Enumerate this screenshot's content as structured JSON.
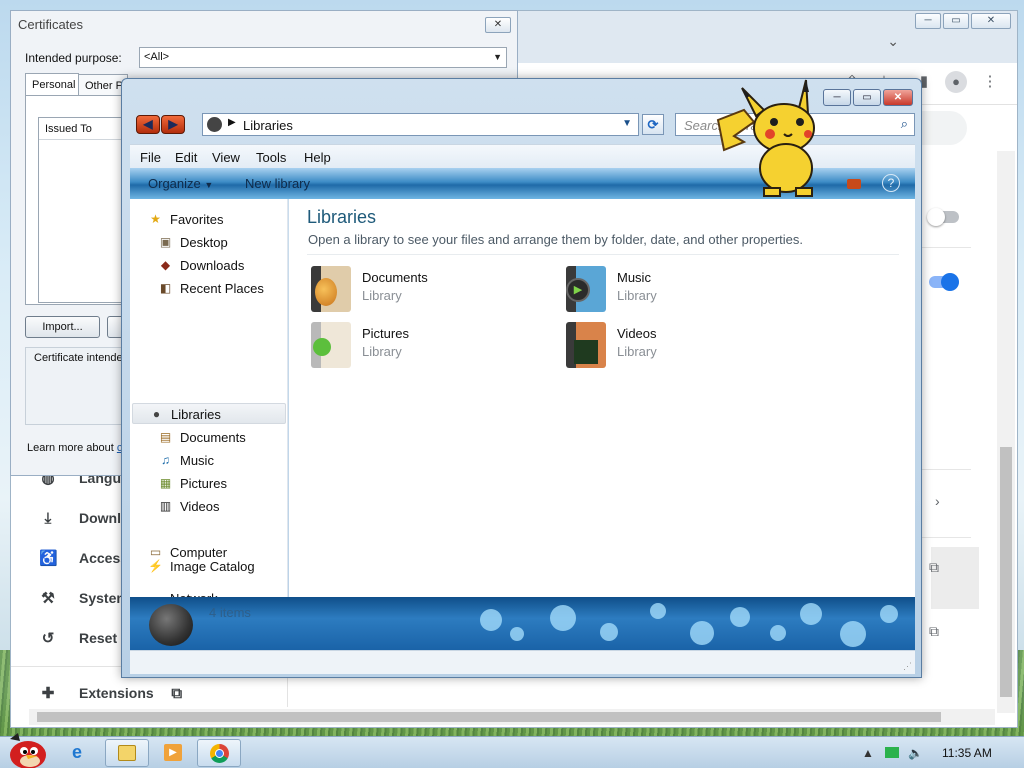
{
  "chrome": {
    "window_controls": [
      "─",
      "▭",
      "✕"
    ],
    "sidebar": [
      {
        "label": "Langua",
        "icon": "globe-icon"
      },
      {
        "label": "Downlo",
        "icon": "download-icon"
      },
      {
        "label": "Access",
        "icon": "accessibility-icon"
      },
      {
        "label": "System",
        "icon": "wrench-icon"
      },
      {
        "label": "Reset a",
        "icon": "history-icon"
      },
      {
        "label": "Extensions",
        "icon": "puzzle-icon"
      }
    ],
    "toggle_on_color": "#1a73e8"
  },
  "certificates": {
    "title": "Certificates",
    "close_glyph": "✕",
    "purpose_label": "Intended purpose:",
    "purpose_value": "<All>",
    "tabs": [
      "Personal",
      "Other Pe"
    ],
    "list_header": "Issued To",
    "import_label": "Import...",
    "purposes_label": "Certificate intende",
    "learn_prefix": "Learn more about ",
    "learn_link": "c"
  },
  "explorer": {
    "window_controls": [
      "─",
      "▭",
      "✕"
    ],
    "address": "Libraries",
    "search_placeholder": "Search Libraries",
    "menu": [
      "File",
      "Edit",
      "View",
      "Tools",
      "Help"
    ],
    "commands": {
      "organize": "Organize",
      "new_library": "New library"
    },
    "nav": {
      "favorites": "Favorites",
      "favorites_items": [
        "Desktop",
        "Downloads",
        "Recent Places"
      ],
      "libraries": "Libraries",
      "libraries_items": [
        "Documents",
        "Music",
        "Pictures",
        "Videos"
      ],
      "computer": "Computer",
      "network": "Network",
      "image_catalog": "Image Catalog"
    },
    "content": {
      "title": "Libraries",
      "subtitle": "Open a library to see your files and arrange them by folder, date, and other properties.",
      "libraries": [
        {
          "name": "Documents",
          "type": "Library"
        },
        {
          "name": "Music",
          "type": "Library"
        },
        {
          "name": "Pictures",
          "type": "Library"
        },
        {
          "name": "Videos",
          "type": "Library"
        }
      ]
    },
    "details": {
      "count": "4 items"
    }
  },
  "taskbar": {
    "clock": "11:35 AM"
  }
}
